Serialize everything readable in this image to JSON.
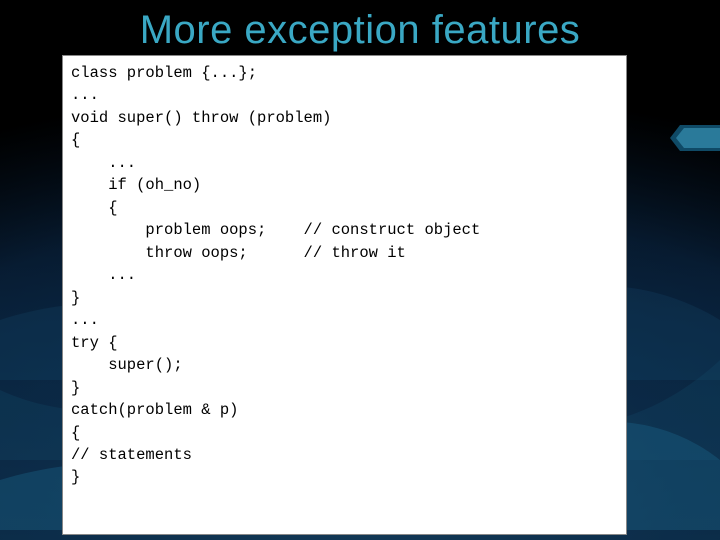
{
  "slide": {
    "title": "More exception features"
  },
  "code": {
    "lines": [
      "class problem {...};",
      "...",
      "void super() throw (problem)",
      "{",
      "    ...",
      "    if (oh_no)",
      "    {",
      "        problem oops;    // construct object",
      "        throw oops;      // throw it",
      "    ...",
      "}",
      "...",
      "try {",
      "    super();",
      "}",
      "catch(problem & p)",
      "{",
      "// statements",
      "}"
    ]
  }
}
